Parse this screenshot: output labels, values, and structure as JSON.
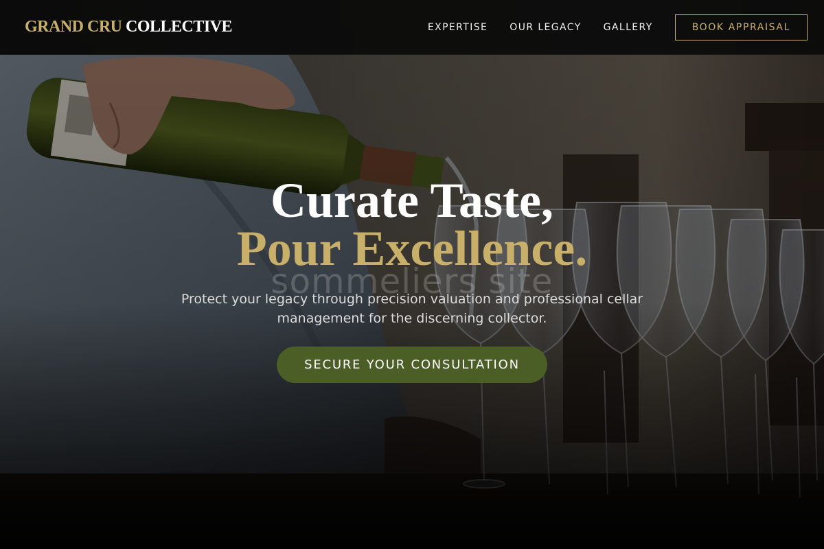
{
  "brand": {
    "name_part1": "GRAND CRU",
    "name_part2": "COLLECTIVE"
  },
  "nav": {
    "items": [
      {
        "label": "EXPERTISE"
      },
      {
        "label": "OUR LEGACY"
      },
      {
        "label": "GALLERY"
      }
    ],
    "cta_label": "BOOK APPRAISAL"
  },
  "hero": {
    "headline_line1": "Curate Taste,",
    "headline_line2": "Pour Excellence.",
    "watermark_text": "sommeliers site",
    "tagline": "Protect your legacy through precision valuation and professional cellar management for the discerning collector.",
    "cta_label": "SECURE YOUR CONSULTATION"
  },
  "colors": {
    "accent_gold": "#c9b06a",
    "button_green": "#4b5e26",
    "nav_background": "#0a0a0a"
  }
}
